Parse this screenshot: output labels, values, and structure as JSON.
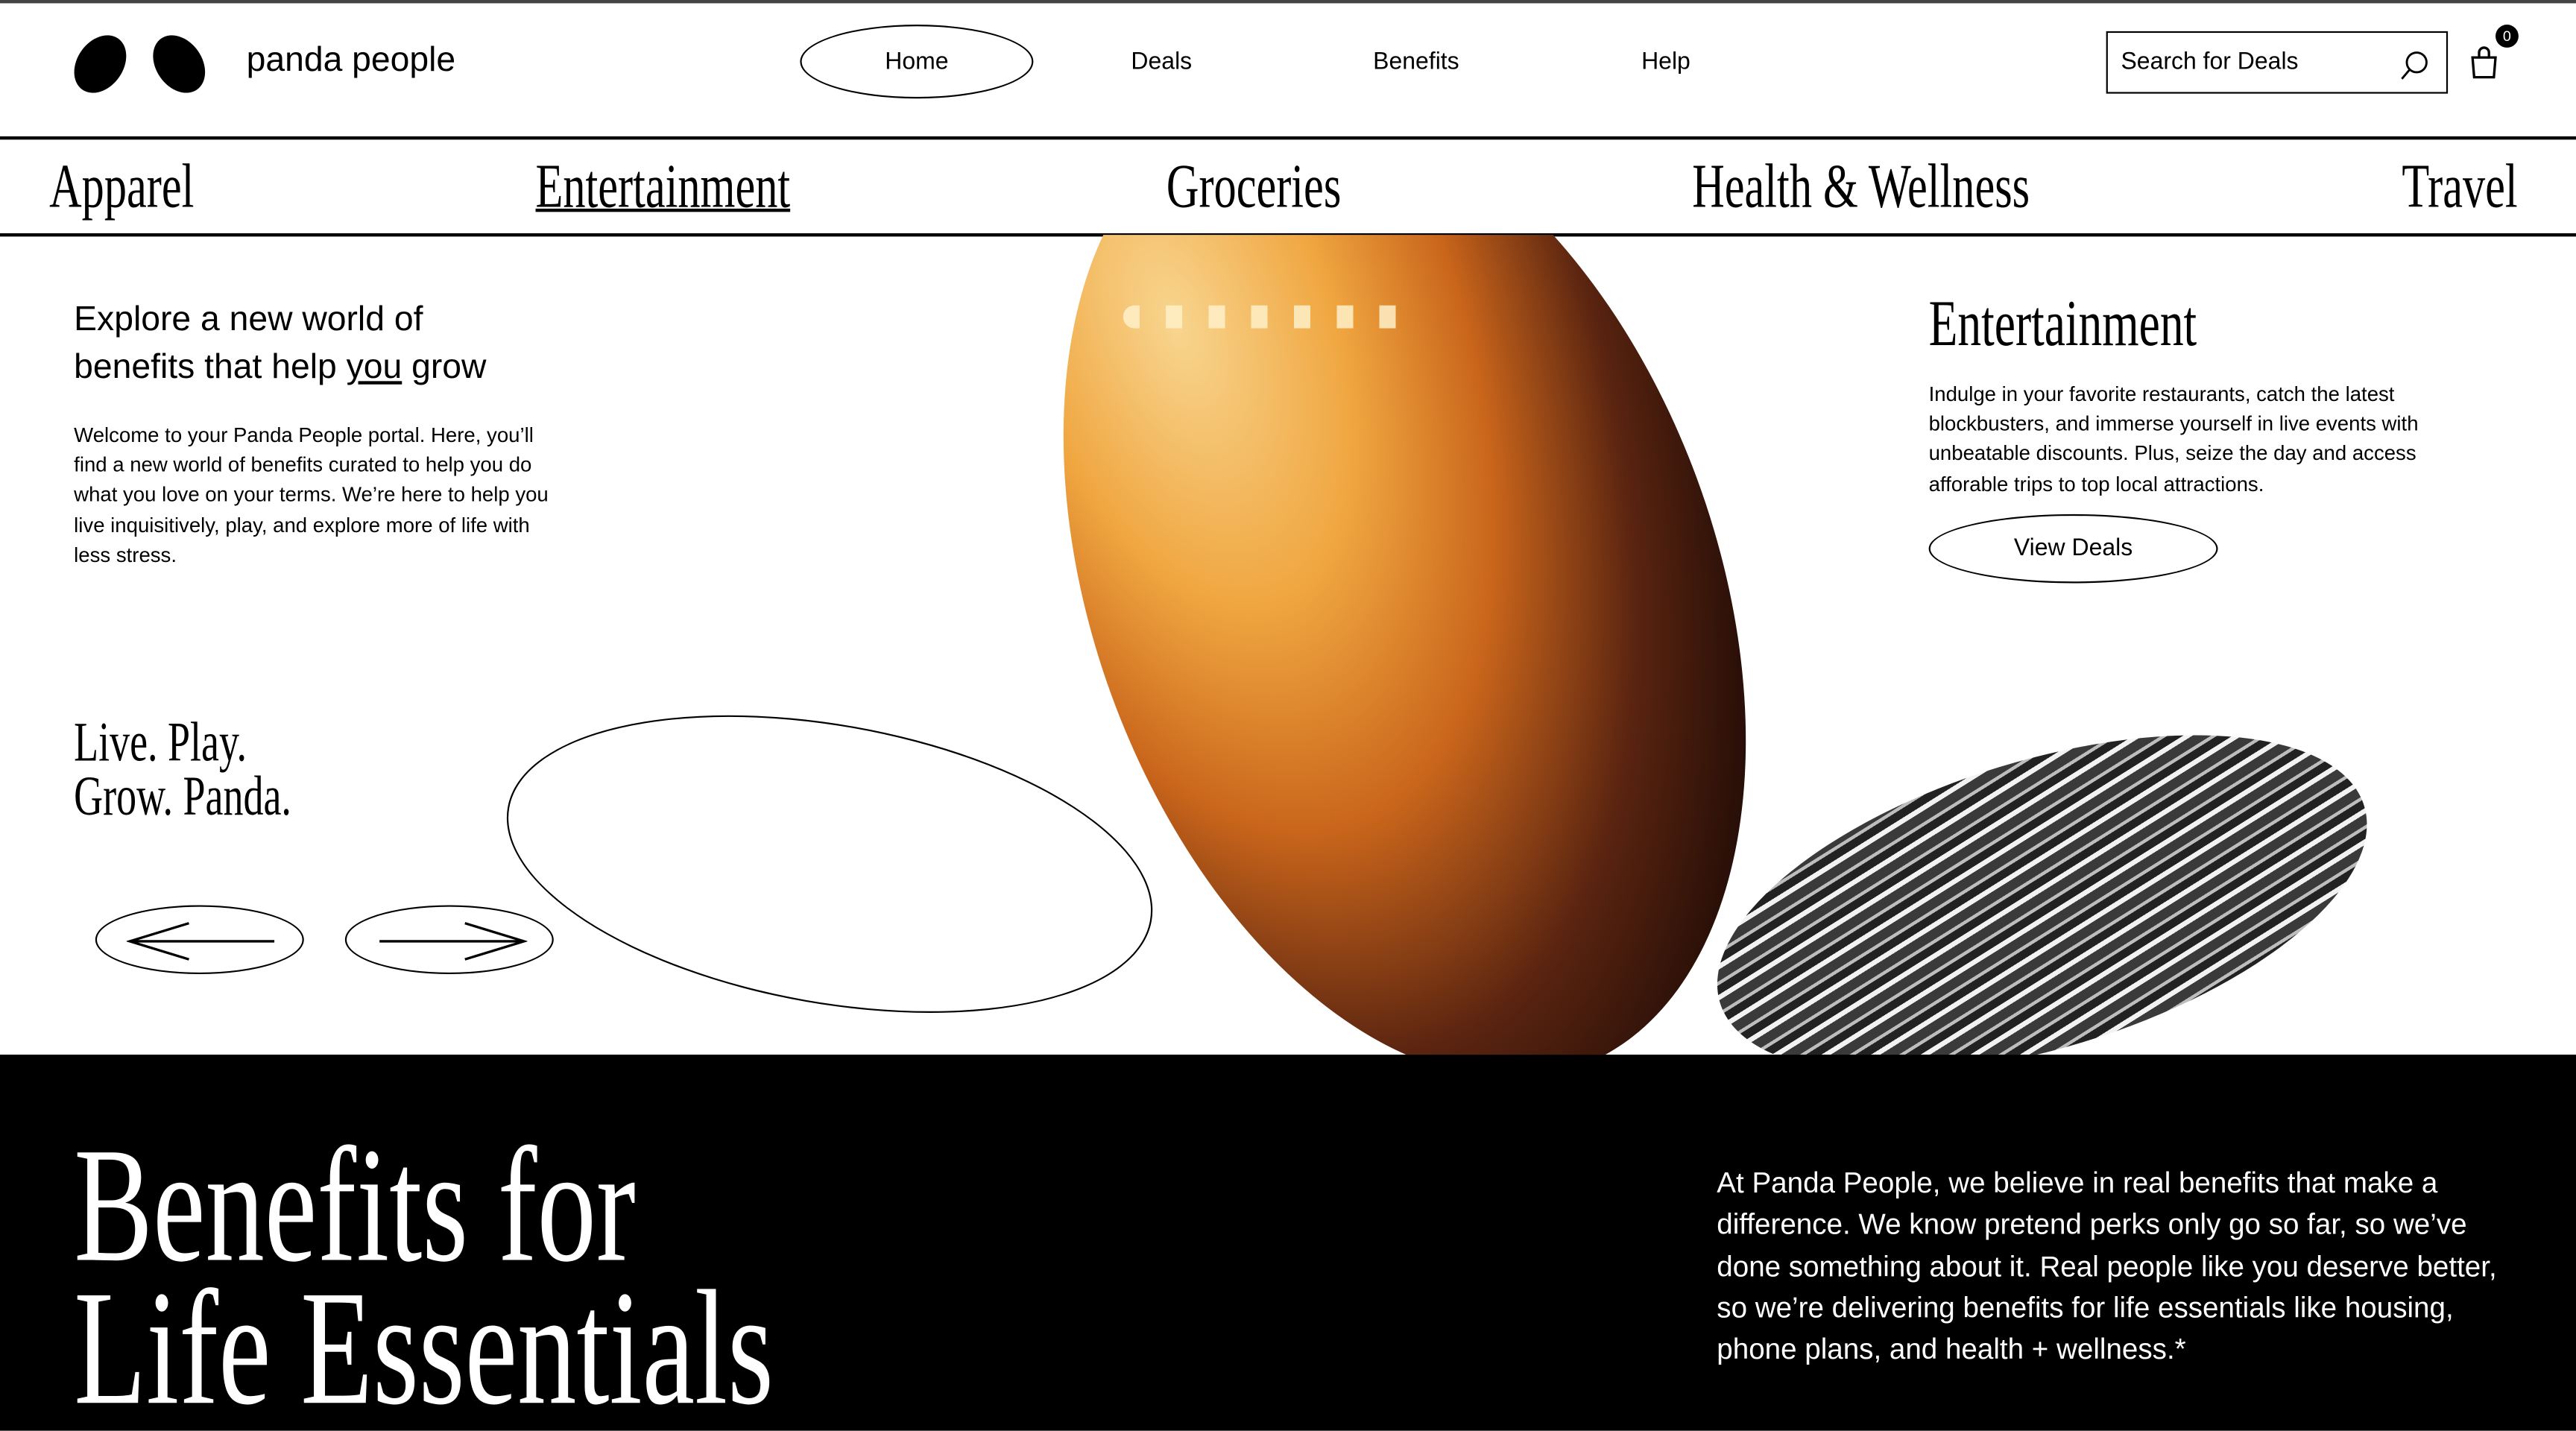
{
  "header": {
    "brand": "panda people",
    "nav": [
      {
        "label": "Home",
        "active": true
      },
      {
        "label": "Deals"
      },
      {
        "label": "Benefits"
      },
      {
        "label": "Help"
      }
    ],
    "search_placeholder": "Search for Deals",
    "cart_count": "0"
  },
  "categories": [
    {
      "label": "Apparel"
    },
    {
      "label": "Entertainment",
      "active": true
    },
    {
      "label": "Groceries"
    },
    {
      "label": "Health & Wellness"
    },
    {
      "label": "Travel"
    }
  ],
  "hero": {
    "heading_pre": "Explore a new world of",
    "heading_line2_a": "benefits that help ",
    "heading_emph": "you",
    "heading_line2_b": " grow",
    "intro": "Welcome to your Panda People portal. Here, you’ll find a new world of benefits curated to help you do what you love on your terms. We’re here to help you live inquisitively, play, and explore more of life with less stress.",
    "tagline_1": "Live. Play.",
    "tagline_2": "Grow. Panda.",
    "prev_icon": "arrow-left",
    "next_icon": "arrow-right"
  },
  "feature": {
    "title": "Entertainment",
    "description": "Indulge in your favorite restaurants, catch the latest blockbusters, and immerse yourself in live events with unbeatable discounts. Plus, seize the day and access afforable trips to top local attractions.",
    "button": "View Deals"
  },
  "about": {
    "headline_1": "Benefits for",
    "headline_2": "Life Essentials",
    "text": "At Panda People, we believe in real benefits that make a difference. We know pretend perks only go so far, so we’ve done something about it. Real people like you deserve better, so we’re delivering benefits for life essentials like housing, phone plans, and health + wellness.*"
  },
  "colors": {
    "background": "#ffffff",
    "text": "#000000",
    "dark_section": "#000000"
  }
}
